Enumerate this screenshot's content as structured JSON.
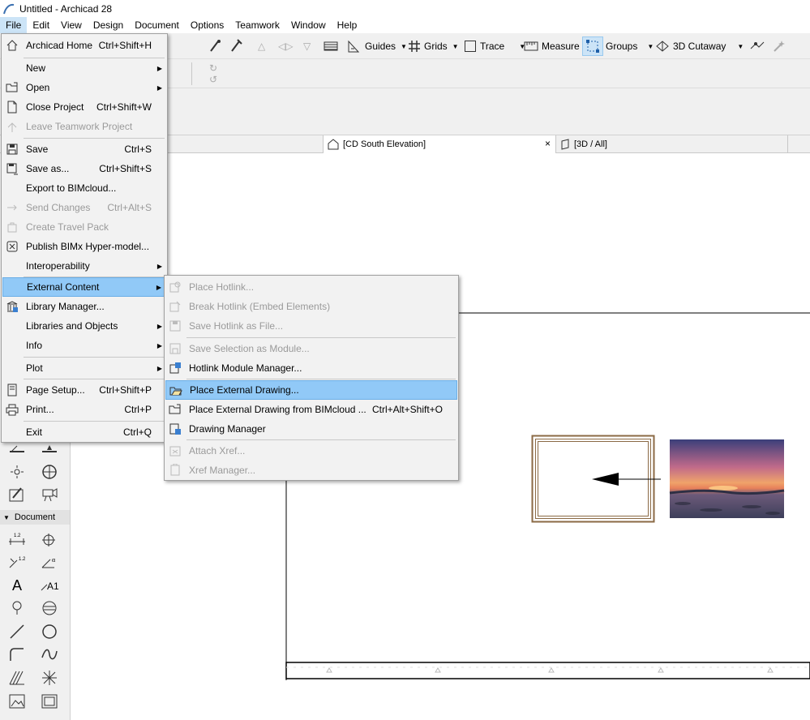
{
  "window": {
    "title": "Untitled - Archicad 28"
  },
  "menubar": [
    "File",
    "Edit",
    "View",
    "Design",
    "Document",
    "Options",
    "Teamwork",
    "Window",
    "Help"
  ],
  "toolbar": {
    "guides": "Guides",
    "grids": "Grids",
    "trace": "Trace",
    "measure": "Measure",
    "groups": "Groups",
    "cutaway": "3D Cutaway"
  },
  "tabs": [
    {
      "label": "[CD South Elevation]",
      "close": "×"
    },
    {
      "label": "[3D / All]"
    }
  ],
  "toolbox": {
    "document_section": "Document"
  },
  "file_menu": {
    "items": [
      {
        "label": "Archicad Home",
        "shortcut": "Ctrl+Shift+H",
        "icon": "home-icon"
      },
      {
        "label": "New",
        "submenu": true
      },
      {
        "label": "Open",
        "submenu": true,
        "icon": "open-folder-icon"
      },
      {
        "label": "Close Project",
        "shortcut": "Ctrl+Shift+W",
        "icon": "close-project-icon"
      },
      {
        "label": "Leave Teamwork Project",
        "disabled": true,
        "icon": "leave-teamwork-icon"
      },
      {
        "label": "Save",
        "shortcut": "Ctrl+S",
        "icon": "save-icon"
      },
      {
        "label": "Save as...",
        "shortcut": "Ctrl+Shift+S",
        "icon": "save-as-icon"
      },
      {
        "label": "Export to BIMcloud...",
        "icon": "export-bimcloud-icon"
      },
      {
        "label": "Send Changes",
        "shortcut": "Ctrl+Alt+S",
        "disabled": true,
        "icon": "send-changes-icon"
      },
      {
        "label": "Create Travel Pack",
        "disabled": true,
        "icon": "travel-pack-icon"
      },
      {
        "label": "Publish BIMx Hyper-model...",
        "icon": "bimx-icon"
      },
      {
        "label": "Interoperability",
        "submenu": true
      },
      {
        "label": "External Content",
        "submenu": true,
        "highlighted": true
      },
      {
        "label": "Library Manager...",
        "icon": "library-icon"
      },
      {
        "label": "Libraries and Objects",
        "submenu": true
      },
      {
        "label": "Info",
        "submenu": true
      },
      {
        "label": "Plot",
        "submenu": true
      },
      {
        "label": "Page Setup...",
        "shortcut": "Ctrl+Shift+P",
        "icon": "page-setup-icon"
      },
      {
        "label": "Print...",
        "shortcut": "Ctrl+P",
        "icon": "print-icon"
      },
      {
        "label": "Exit",
        "shortcut": "Ctrl+Q"
      }
    ]
  },
  "external_content_menu": {
    "items": [
      {
        "label": "Place Hotlink...",
        "disabled": true,
        "icon": "place-hotlink-icon"
      },
      {
        "label": "Break Hotlink (Embed Elements)",
        "disabled": true,
        "icon": "break-hotlink-icon"
      },
      {
        "label": "Save Hotlink as File...",
        "disabled": true,
        "icon": "save-hotlink-icon"
      },
      {
        "label": "Save Selection as Module...",
        "disabled": true,
        "icon": "save-module-icon"
      },
      {
        "label": "Hotlink Module Manager...",
        "icon": "hotlink-manager-icon"
      },
      {
        "label": "Place External Drawing...",
        "highlighted": true,
        "icon": "place-drawing-icon"
      },
      {
        "label": "Place External Drawing from BIMcloud ...",
        "shortcut": "Ctrl+Alt+Shift+O",
        "icon": "place-drawing-bimcloud-icon"
      },
      {
        "label": "Drawing Manager",
        "icon": "drawing-manager-icon"
      },
      {
        "label": "Attach Xref...",
        "disabled": true,
        "icon": "attach-xref-icon"
      },
      {
        "label": "Xref Manager...",
        "disabled": true,
        "icon": "xref-manager-icon"
      }
    ]
  },
  "colors": {
    "menu_highlight": "#91c9f7",
    "frame": "#8b6a45",
    "sunset_sky": "#c06a8a"
  }
}
